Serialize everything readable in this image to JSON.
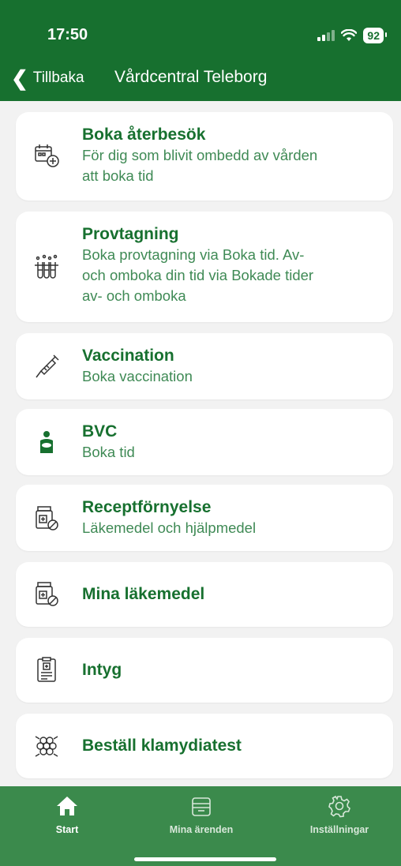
{
  "status": {
    "time": "17:50",
    "battery": "92"
  },
  "nav": {
    "back_label": "Tillbaka",
    "title": "Vårdcentral Teleborg"
  },
  "items": [
    {
      "title": "Boka återbesök",
      "subtitle": [
        "För dig som blivit ombedd av vården",
        "att boka tid"
      ],
      "icon": "calendar-plus-icon"
    },
    {
      "title": "Provtagning",
      "subtitle": [
        "Boka provtagning via Boka tid. Av-",
        "och omboka din tid via Bokade tider",
        "av- och omboka"
      ],
      "icon": "test-tubes-icon"
    },
    {
      "title": "Vaccination",
      "subtitle": [
        "Boka vaccination"
      ],
      "icon": "syringe-icon"
    },
    {
      "title": "BVC",
      "subtitle": [
        "Boka tid"
      ],
      "icon": "parent-child-icon"
    },
    {
      "title": "Receptförnyelse",
      "subtitle": [
        "Läkemedel och hjälpmedel"
      ],
      "icon": "medicine-jar-icon"
    },
    {
      "title": "Mina läkemedel",
      "subtitle": [],
      "icon": "medicine-jar-icon"
    },
    {
      "title": "Intyg",
      "subtitle": [],
      "icon": "certificate-icon"
    },
    {
      "title": "Beställ klamydiatest",
      "subtitle": [],
      "icon": "bacteria-icon"
    }
  ],
  "tabs": [
    {
      "label": "Start",
      "icon": "home-icon",
      "active": true
    },
    {
      "label": "Mina ärenden",
      "icon": "inbox-tray-icon",
      "active": false
    },
    {
      "label": "Inställningar",
      "icon": "gear-icon",
      "active": false
    }
  ],
  "colors": {
    "brand": "#17702f",
    "tabbar": "#3b8a4c",
    "background": "#f2f2f2"
  }
}
